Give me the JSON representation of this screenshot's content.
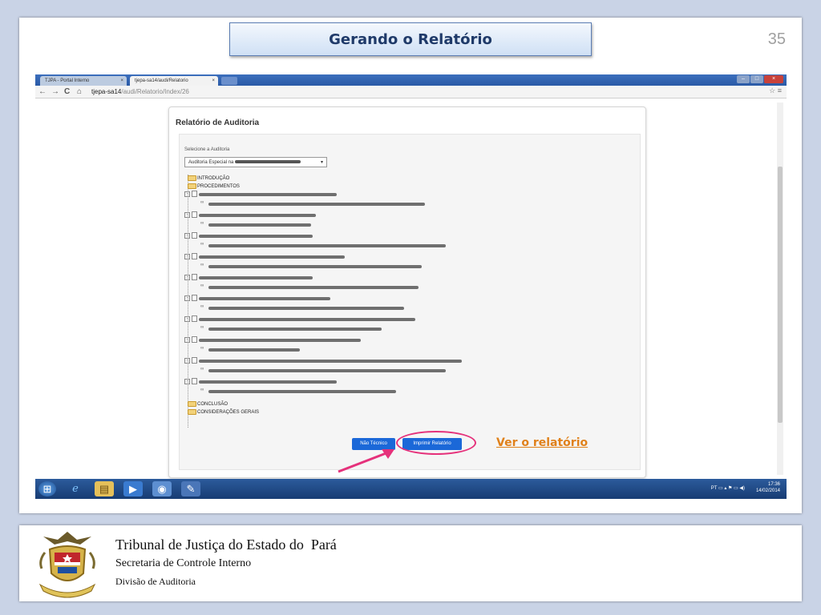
{
  "slide": {
    "title": "Gerando o Relatório",
    "number": "35"
  },
  "browser": {
    "tabs": [
      {
        "label": "TJPA - Portal Interno",
        "close": "×"
      },
      {
        "label": "tjepa-sa14/audi/Relatorio",
        "close": "×"
      }
    ],
    "url_host": "tjepa-sa14",
    "url_path": "/audi/Relatorio/Index/26",
    "nav": {
      "back": "←",
      "forward": "→",
      "reload": "C",
      "home": "⌂"
    },
    "star": "☆ ≡"
  },
  "page": {
    "panel_title": "Relatório de Auditoria",
    "select_label": "Selecione a Auditoria",
    "select_value": "Auditoria Especial na",
    "tree": {
      "introducao": "INTRODUÇÃO",
      "procedimentos": "PROCEDIMENTOS",
      "conclusao": "CONCLUSÃO",
      "consideracoes": "CONSIDERAÇÕES GERAIS"
    },
    "buttons": {
      "nao_tecnico": "Não Técnico",
      "imprimir": "Imprimir Relatório"
    }
  },
  "annotation": {
    "link_text": "Ver o relatório",
    "highlight_color": "#e5317b",
    "link_color": "#e0811a"
  },
  "taskbar": {
    "tray_lang": "PT",
    "time": "17:36",
    "date": "14/02/2014"
  },
  "footer": {
    "org_name": "Tribunal de Justiça do Estado do  Pará",
    "secretaria": "Secretaria de Controle Interno",
    "divisao": "Divisão de Auditoria"
  },
  "icons": [
    "chrome-favicon-icon",
    "page-icon",
    "back-icon",
    "forward-icon",
    "reload-icon",
    "home-icon",
    "star-icon",
    "menu-icon",
    "folder-icon",
    "document-icon",
    "windows-start-icon",
    "ie-icon",
    "explorer-icon",
    "media-player-icon",
    "chrome-icon",
    "paint-icon",
    "coat-of-arms-icon"
  ]
}
